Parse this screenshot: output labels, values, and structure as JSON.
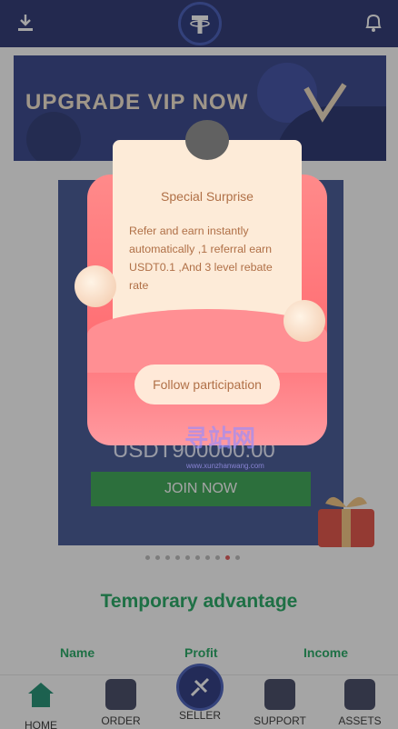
{
  "header": {
    "download_icon": "download-icon",
    "bell_icon": "bell-icon",
    "logo_icon": "tether-logo-icon"
  },
  "banner": {
    "title": "UPGRADE VIP NOW"
  },
  "vip_card": {
    "amount": "USDT900000.00",
    "join_label": "JOIN NOW"
  },
  "carousel": {
    "count": 10,
    "active_index": 8
  },
  "advantage": {
    "title": "Temporary advantage",
    "columns": [
      "Name",
      "Profit",
      "Income"
    ]
  },
  "popup": {
    "title": "Special Surprise",
    "body": "Refer and earn instantly automatically ,1 referral earn USDT0.1 ,And 3 level rebate rate",
    "button_label": "Follow participation"
  },
  "watermark": {
    "text": "寻站网",
    "subtext": "www.xunzhanwang.com"
  },
  "nav": {
    "items": [
      {
        "label": "HOME",
        "icon": "home-icon"
      },
      {
        "label": "ORDER",
        "icon": "order-icon"
      },
      {
        "label": "SELLER",
        "icon": "seller-icon"
      },
      {
        "label": "SUPPORT",
        "icon": "support-icon"
      },
      {
        "label": "ASSETS",
        "icon": "wallet-icon"
      }
    ]
  },
  "colors": {
    "header": "#1f2a6b",
    "accent_green": "#17a45a",
    "join_button": "#2fa34b",
    "popup_text": "#b07047"
  }
}
